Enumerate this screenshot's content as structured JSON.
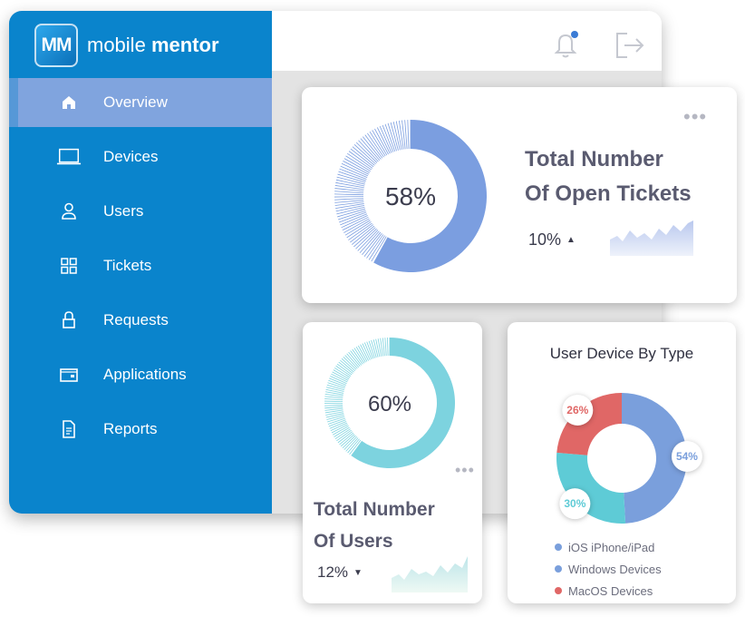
{
  "brand": {
    "mark": "MM",
    "name_light": "mobile",
    "name_bold": "mentor"
  },
  "nav": [
    {
      "label": "Overview",
      "icon": "home-icon",
      "active": true
    },
    {
      "label": "Devices",
      "icon": "laptop-icon",
      "active": false
    },
    {
      "label": "Users",
      "icon": "user-icon",
      "active": false
    },
    {
      "label": "Tickets",
      "icon": "grid-icon",
      "active": false
    },
    {
      "label": "Requests",
      "icon": "lock-icon",
      "active": false
    },
    {
      "label": "Applications",
      "icon": "wallet-icon",
      "active": false
    },
    {
      "label": "Reports",
      "icon": "document-icon",
      "active": false
    }
  ],
  "header": {
    "icons": [
      "bell-icon",
      "logout-icon"
    ]
  },
  "tickets_card": {
    "title_line1": "Total Number",
    "title_line2": "Of Open Tickets",
    "percent": 58,
    "percent_label": "58%",
    "trend": "10%",
    "trend_direction": "up",
    "color": "#7b9ee0"
  },
  "users_card": {
    "title_line1": "Total Number",
    "title_line2": "Of Users",
    "percent": 60,
    "percent_label": "60%",
    "trend": "12%",
    "trend_direction": "down",
    "color": "#7dd3df"
  },
  "chart_data": {
    "type": "pie",
    "title": "User Device By Type",
    "slices": [
      {
        "label": "54%",
        "value": 54,
        "color": "#7a9fdc"
      },
      {
        "label": "30%",
        "value": 30,
        "color": "#5ecbd6"
      },
      {
        "label": "26%",
        "value": 26,
        "color": "#e06766"
      }
    ],
    "legend": [
      {
        "name": "iOS iPhone/iPad",
        "color": "#7a9fdc"
      },
      {
        "name": "Windows Devices",
        "color": "#7a9fdc"
      },
      {
        "name": "MacOS Devices",
        "color": "#e06766"
      }
    ],
    "legend_position": "bottom"
  },
  "colors": {
    "sidebar": "#0a84cc",
    "active_item": "#80a4de",
    "title_text": "#5a5b70"
  }
}
